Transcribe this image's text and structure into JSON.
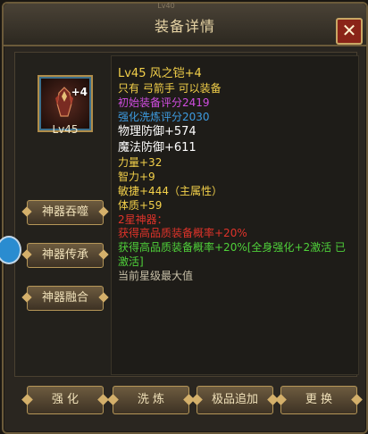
{
  "window": {
    "title": "装备详情",
    "top_hint": "Lv40",
    "close_label": "✕"
  },
  "item": {
    "badge": "+4",
    "level_label": "Lv45"
  },
  "side_buttons": [
    {
      "label": "神器吞噬"
    },
    {
      "label": "神器传承"
    },
    {
      "label": "神器融合"
    }
  ],
  "details": [
    {
      "text": "Lv45 风之铠+4",
      "color": "#f3d04a",
      "big": true
    },
    {
      "text": "只有 弓箭手 可以装备",
      "color": "#f3d04a"
    },
    {
      "text": "初始装备评分2419",
      "color": "#d04de0"
    },
    {
      "text": "强化洗炼评分2030",
      "color": "#3d9be0"
    },
    {
      "text": "物理防御+574",
      "color": "#ffffff",
      "big": true
    },
    {
      "text": "魔法防御+611",
      "color": "#ffffff",
      "big": true
    },
    {
      "text": "力量+32",
      "color": "#f3d04a"
    },
    {
      "text": "智力+9",
      "color": "#f3d04a"
    },
    {
      "text": "敏捷+444（主属性）",
      "color": "#f3d04a"
    },
    {
      "text": "体质+59",
      "color": "#f3d04a"
    },
    {
      "text": "2星神器：",
      "color": "#e0332a"
    },
    {
      "text": "获得高品质装备概率+20%",
      "color": "#e0332a"
    },
    {
      "text": "获得高品质装备概率+20%[全身强化+2激活 已激活]",
      "color": "#4fd13a",
      "wrap": true
    },
    {
      "text": "当前星级最大值",
      "color": "#c8c0a8"
    }
  ],
  "bottom_buttons": [
    {
      "label": "强 化"
    },
    {
      "label": "洗 炼"
    },
    {
      "label": "极品追加"
    },
    {
      "label": "更 换"
    }
  ],
  "colors": {
    "panel_bg": "#2a2620",
    "border_gold": "#b69758",
    "close_red": "#8a2418"
  }
}
